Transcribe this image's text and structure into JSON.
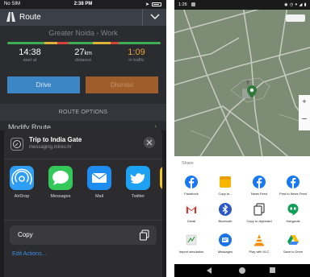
{
  "ios": {
    "status": {
      "carrier": "No SIM",
      "time": "2:38 PM"
    },
    "header": {
      "title": "Route"
    },
    "destination": "Greater Noida - Work",
    "stats": [
      {
        "value": "14:38",
        "unit": "",
        "label": "start at"
      },
      {
        "value": "27",
        "unit": "km",
        "label": "distance"
      },
      {
        "value": "1:09",
        "unit": "",
        "label": "in traffic"
      }
    ],
    "buttons": {
      "drive": "Drive",
      "dismiss": "Dismiss"
    },
    "route_options": "ROUTE OPTIONS",
    "modify_route": "Modify Route",
    "share": {
      "title": "Trip to India Gate",
      "subtitle": "messaging.mireo.hr",
      "apps": [
        {
          "label": "AirDrop",
          "icon": "airdrop-icon",
          "color": "#2f9ef5"
        },
        {
          "label": "Messages",
          "icon": "messages-icon",
          "color": "#34c759"
        },
        {
          "label": "Mail",
          "icon": "mail-icon",
          "color": "#1f8cf0"
        },
        {
          "label": "Twitter",
          "icon": "twitter-icon",
          "color": "#1da1f2"
        }
      ],
      "copy": "Copy",
      "edit_actions": "Edit Actions..."
    }
  },
  "android": {
    "status": {
      "time": "1:26"
    },
    "share_title": "Share",
    "apps": [
      {
        "label": "Facebook",
        "icon": "facebook-icon"
      },
      {
        "label": "Copy to...",
        "icon": "copy-to-icon"
      },
      {
        "label": "News Feed",
        "icon": "facebook-icon"
      },
      {
        "label": "Post to News Feed",
        "icon": "facebook-icon"
      },
      {
        "label": "Gmail",
        "icon": "gmail-icon"
      },
      {
        "label": "Bluetooth",
        "icon": "bluetooth-icon"
      },
      {
        "label": "Copy to clipboard",
        "icon": "clipboard-icon"
      },
      {
        "label": "Hangouts",
        "icon": "hangouts-icon"
      },
      {
        "label": "Import simulation",
        "icon": "import-icon"
      },
      {
        "label": "Messages",
        "icon": "messages-icon"
      },
      {
        "label": "Play with VLC",
        "icon": "vlc-icon"
      },
      {
        "label": "Save to Drive",
        "icon": "drive-icon"
      }
    ]
  },
  "colors": {
    "ios_bg": "#1e1e20",
    "drive": "#3d86c6",
    "dismiss": "#9e5d2a",
    "traffic_delay": "#e8a23a",
    "facebook": "#1877f2",
    "map": "#7d8c75"
  }
}
